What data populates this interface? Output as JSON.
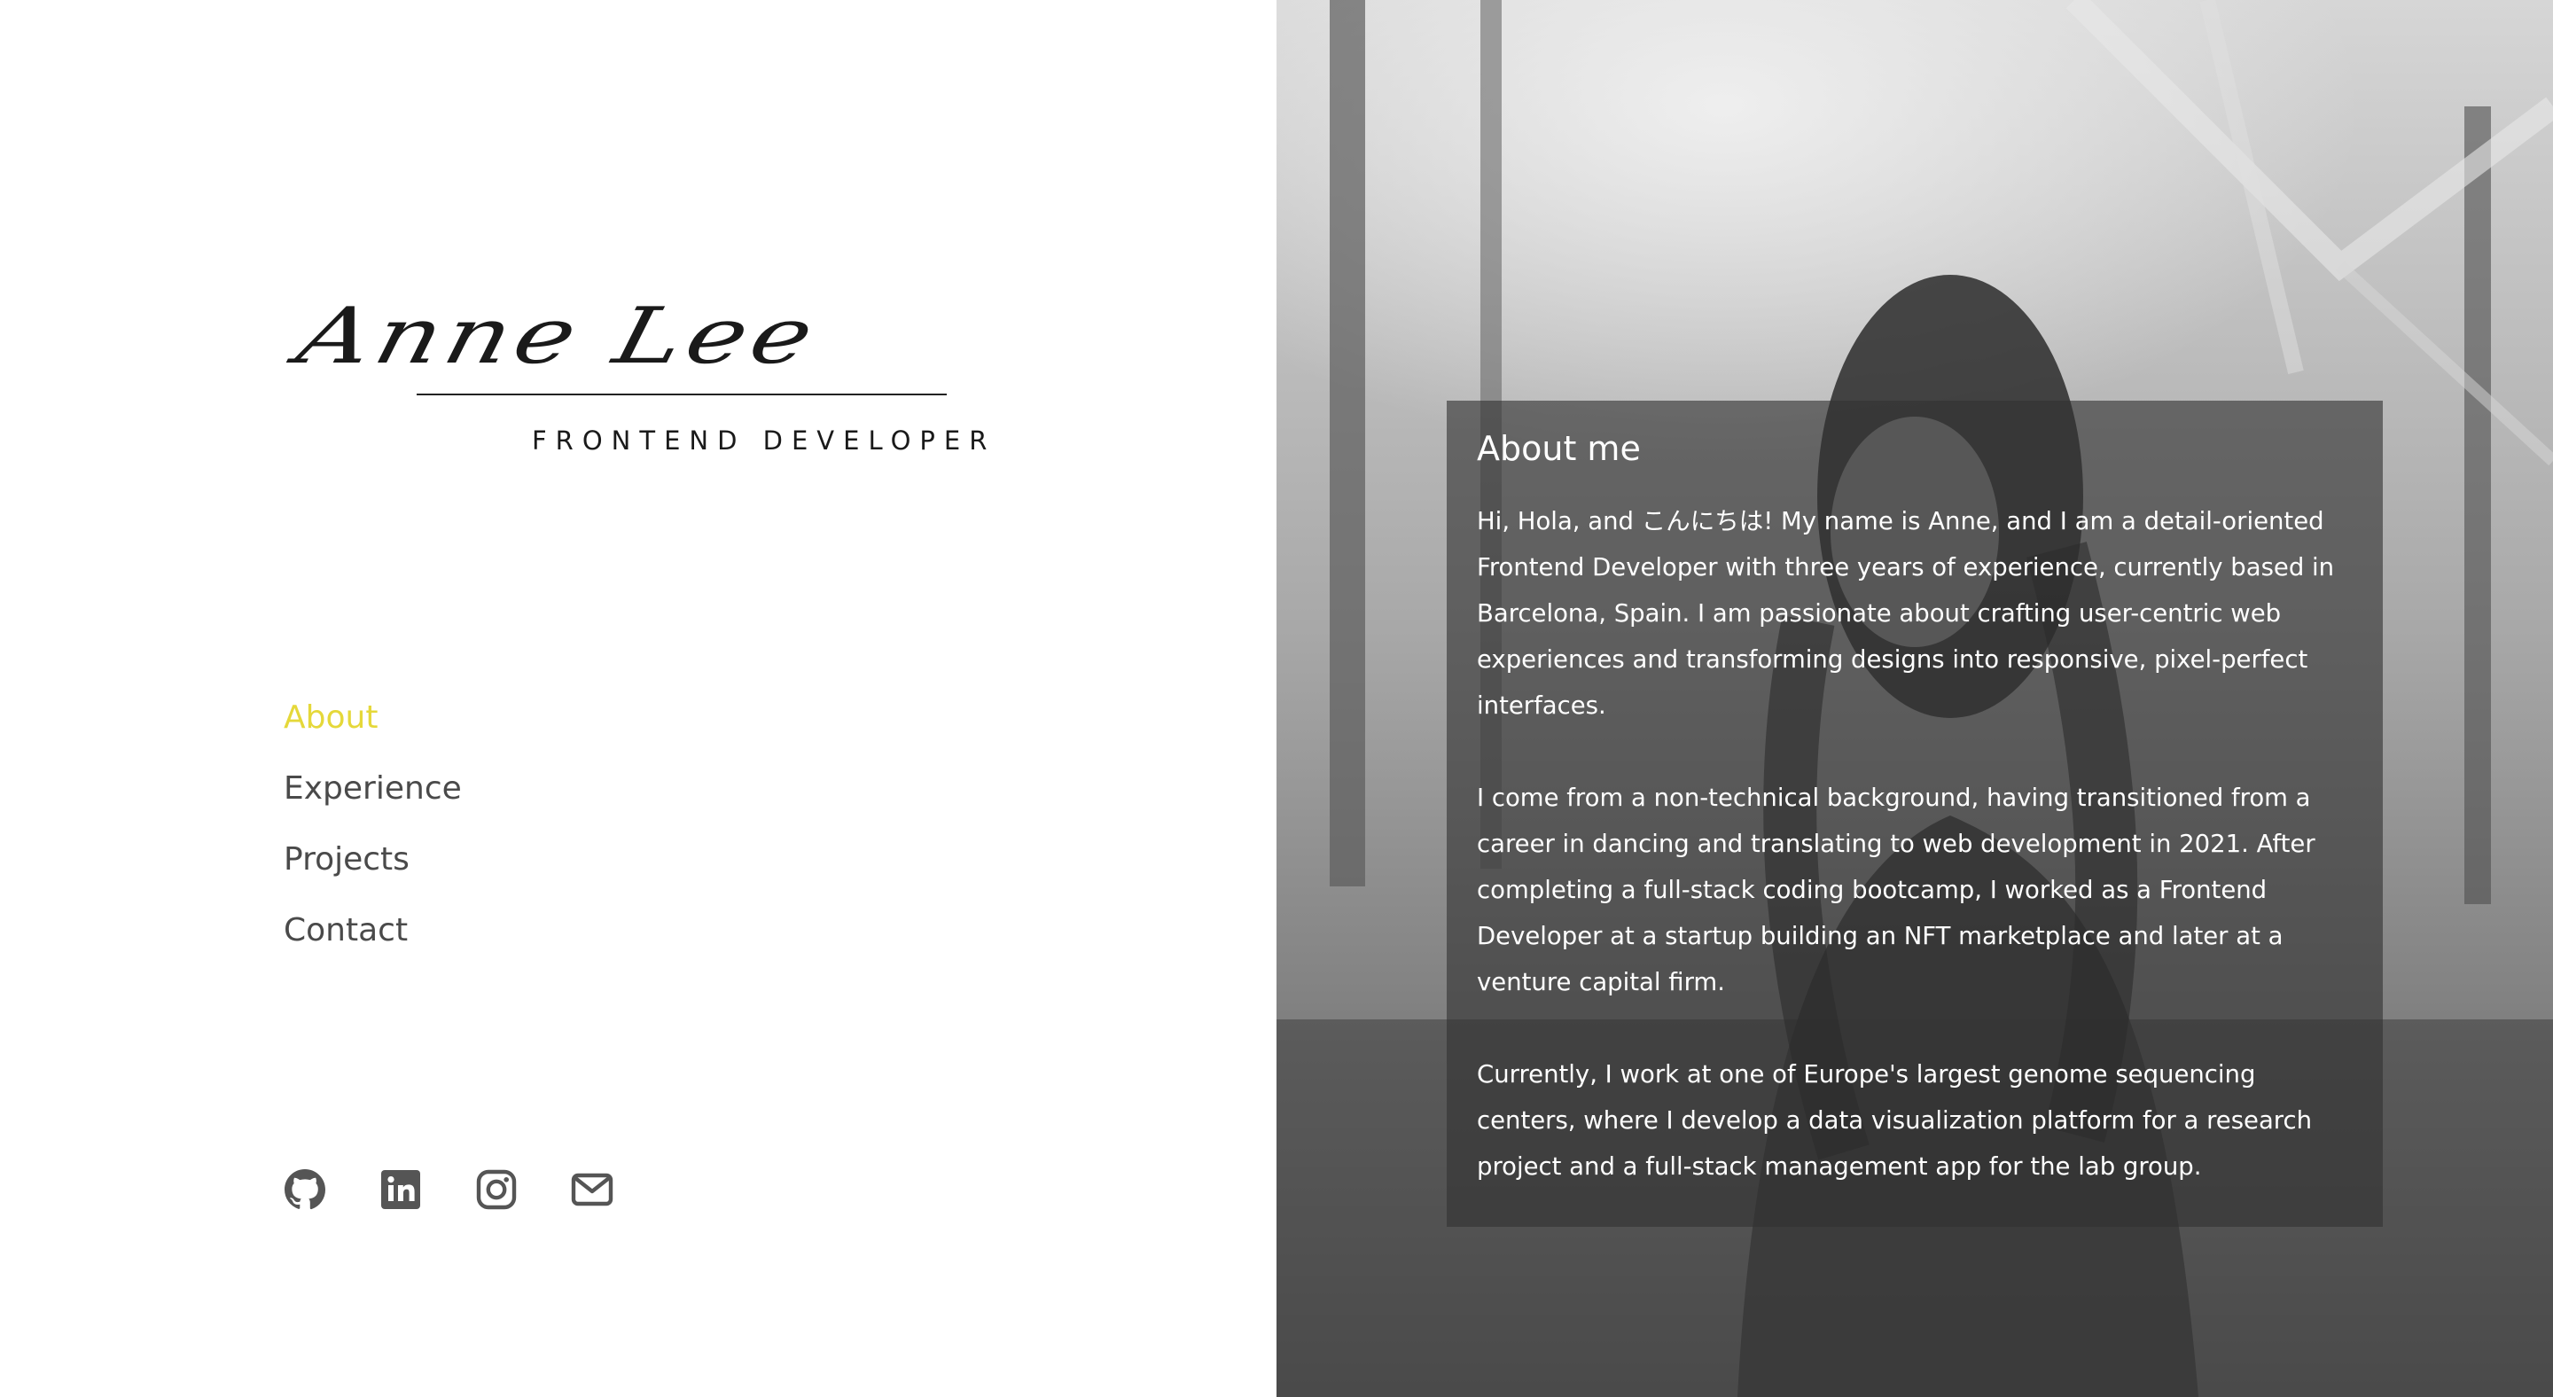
{
  "header": {
    "signature": "Anne Lee",
    "role": "FRONTEND DEVELOPER"
  },
  "nav": {
    "items": [
      {
        "label": "About",
        "active": true
      },
      {
        "label": "Experience",
        "active": false
      },
      {
        "label": "Projects",
        "active": false
      },
      {
        "label": "Contact",
        "active": false
      }
    ]
  },
  "socials": [
    {
      "icon": "github-icon"
    },
    {
      "icon": "linkedin-icon"
    },
    {
      "icon": "instagram-icon"
    },
    {
      "icon": "mail-icon"
    }
  ],
  "about": {
    "title": "About me",
    "paragraphs": [
      "Hi, Hola, and こんにちは! My name is Anne, and I am a detail-oriented Frontend Developer with three years of experience, currently based in Barcelona, Spain. I am passionate about crafting user-centric web experiences and transforming designs into responsive, pixel-perfect interfaces.",
      "I come from a non-technical background, having transitioned from a career in dancing and translating to web development in 2021. After completing a full-stack coding bootcamp, I worked as a Frontend Developer at a startup building an NFT marketplace and later at a venture capital firm.",
      "Currently, I work at one of Europe's largest genome sequencing centers, where I develop a data visualization platform for a research project and a full-stack management app for the lab group."
    ]
  },
  "colors": {
    "accent": "#e5d83a",
    "nav_text": "#4a4a4a",
    "icon": "#555555",
    "card_bg": "rgba(50,50,50,0.62)"
  }
}
